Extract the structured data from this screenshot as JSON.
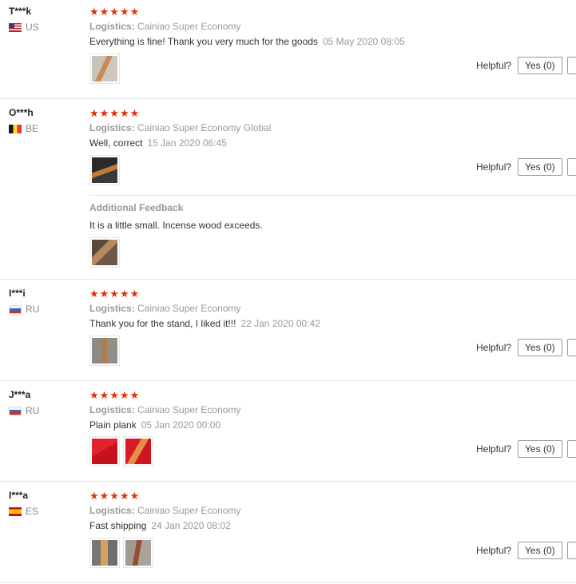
{
  "helpful_label": "Helpful?",
  "reviews": [
    {
      "user": "T***k",
      "country": "US",
      "flag": "flag-us",
      "stars": "★★★★★",
      "logistics_label": "Logistics:",
      "logistics_value": "Cainiao Super Economy",
      "comment": "Everything is fine! Thank you very much for the goods",
      "date": "05 May 2020 08:05",
      "photos": [
        "wooden-plank-photo"
      ],
      "yes_label": "Yes (0)"
    },
    {
      "user": "O***h",
      "country": "BE",
      "flag": "flag-be",
      "stars": "★★★★★",
      "logistics_label": "Logistics:",
      "logistics_value": "Cainiao Super Economy Global",
      "comment": "Well, correct",
      "date": "15 Jan 2020 06:45",
      "photos": [
        "incense-holder-photo"
      ],
      "yes_label": "Yes (0)",
      "additional": {
        "title": "Additional Feedback",
        "text": "It is a little small. Incense wood exceeds.",
        "photos": [
          "incense-wood-photo"
        ]
      }
    },
    {
      "user": "I***i",
      "country": "RU",
      "flag": "flag-ru",
      "stars": "★★★★★",
      "logistics_label": "Logistics:",
      "logistics_value": "Cainiao Super Economy",
      "comment": "Thank you for the stand, I liked it!!!",
      "date": "22 Jan 2020 00:42",
      "photos": [
        "stand-photo"
      ],
      "yes_label": "Yes (0)"
    },
    {
      "user": "J***a",
      "country": "RU",
      "flag": "flag-ru",
      "stars": "★★★★★",
      "logistics_label": "Logistics:",
      "logistics_value": "Cainiao Super Economy",
      "comment": "Plain plank",
      "date": "05 Jan 2020 00:00",
      "photos": [
        "red-background-photo",
        "plank-on-red-photo"
      ],
      "yes_label": "Yes (0)"
    },
    {
      "user": "I***a",
      "country": "ES",
      "flag": "flag-es",
      "stars": "★★★★★",
      "logistics_label": "Logistics:",
      "logistics_value": "Cainiao Super Economy",
      "comment": "Fast shipping",
      "date": "24 Jan 2020 08:02",
      "photos": [
        "plank-front-photo",
        "plank-side-photo"
      ],
      "yes_label": "Yes (0)"
    }
  ]
}
